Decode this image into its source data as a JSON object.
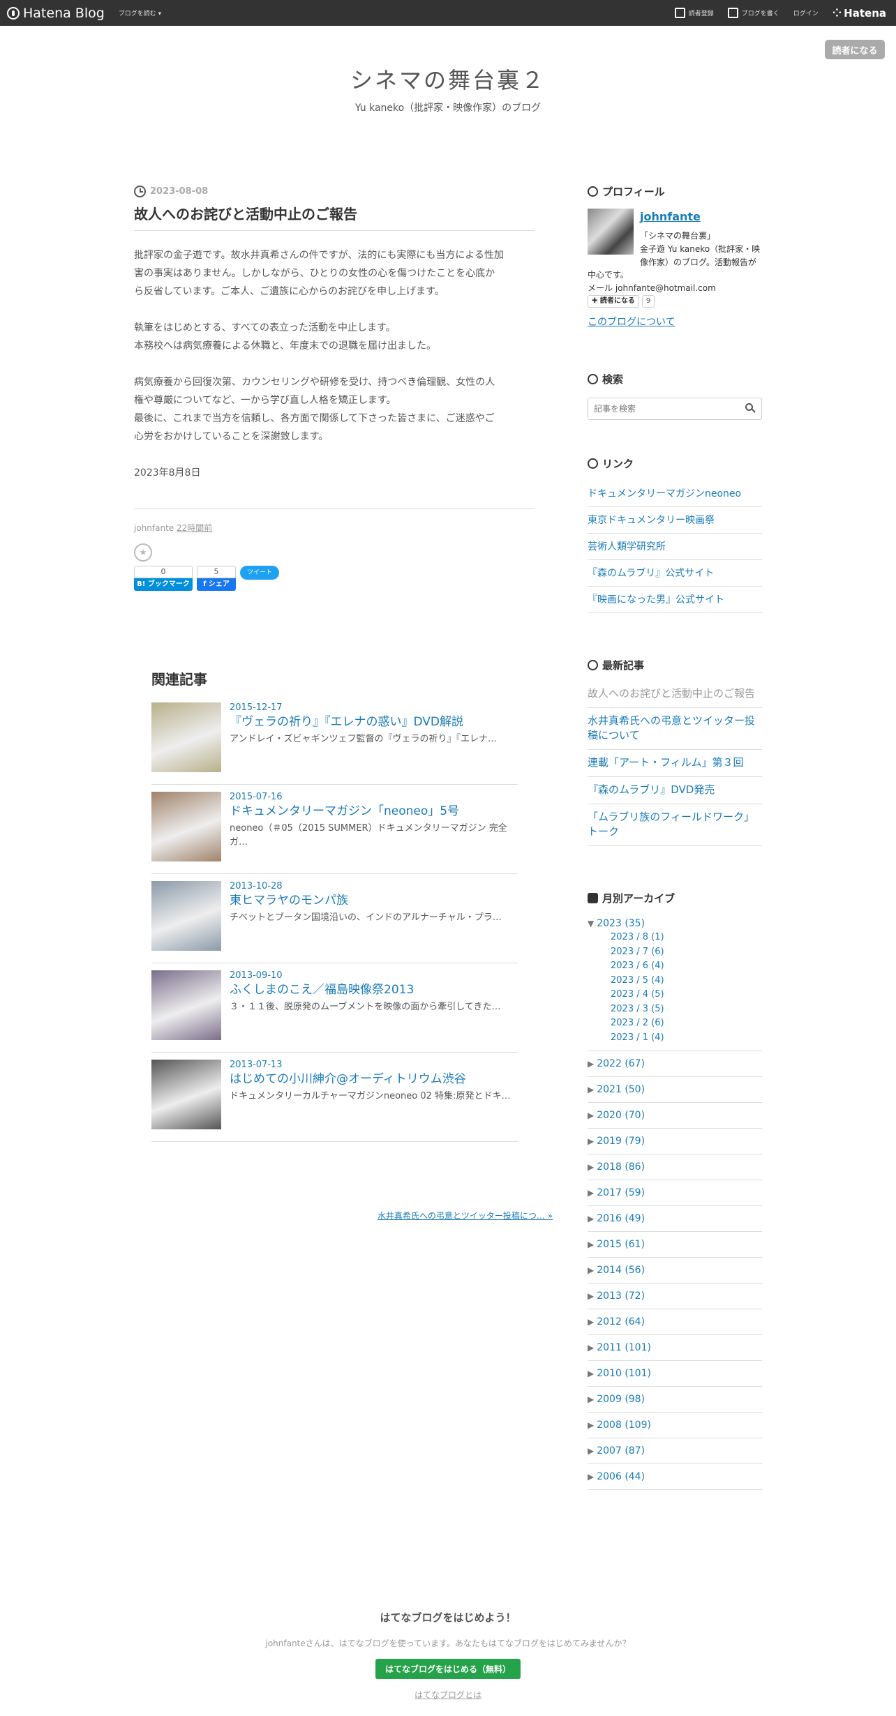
{
  "topbar": {
    "logo": "Hatena Blog",
    "menu": "ブログを読む ▾",
    "right_items": [
      "読者登録",
      "ブログを書く",
      "ログイン"
    ],
    "brand": "Hatena"
  },
  "subscribe_button": "読者になる",
  "header": {
    "title": "シネマの舞台裏２",
    "description": "Yu kaneko（批評家・映像作家）のブログ"
  },
  "entry": {
    "date": "2023-08-08",
    "title": "故人へのお詫びと活動中止のご報告",
    "paragraphs": [
      [
        "批評家の金子遊です。故水井真希さんの件ですが、法的にも実際にも当方による性加",
        "害の事実はありません。しかしながら、ひとりの女性の心を傷つけたことを心底か",
        "ら反省しています。ご本人、ご遺族に心からのお詫びを申し上げます。"
      ],
      [
        "執筆をはじめとする、すべての表立った活動を中止します。",
        "本務校へは病気療養による休職と、年度末での退職を届け出ました。"
      ],
      [
        "病気療養から回復次第、カウンセリングや研修を受け、持つべき倫理観、女性の人",
        "権や尊厳についてなど、一から学び直し人格を矯正します。",
        "最後に、これまで当方を信頼し、各方面で関係して下さった皆さまに、ご迷惑やご",
        "心労をおかけしていることを深謝致します。"
      ],
      [
        "2023年8月8日"
      ]
    ],
    "author": "johnfante",
    "time_ago": "22時間前",
    "share": {
      "hatebu_count": "0",
      "hatebu_label": "B! ブックマーク",
      "fb_count": "5",
      "fb_label": "f シェア",
      "tweet_label": "ツイート"
    }
  },
  "related": {
    "heading": "関連記事",
    "items": [
      {
        "date": "2015-12-17",
        "title": "『ヴェラの祈り』『エレナの惑い』DVD解説",
        "snippet": "アンドレイ・ズビャギンツェフ監督の『ヴェラの祈り』『エレナ…",
        "thumb_color": "#b8b08a"
      },
      {
        "date": "2015-07-16",
        "title": "ドキュメンタリーマガジン「neoneo」5号",
        "snippet": "neoneo（＃05（2015 SUMMER）ドキュメンタリーマガジン 完全ガ…",
        "thumb_color": "#a0826a"
      },
      {
        "date": "2013-10-28",
        "title": "東ヒマラヤのモンパ族",
        "snippet": "チベットとブータン国境沿いの、インドのアルナーチャル・プラ…",
        "thumb_color": "#8a9aa8"
      },
      {
        "date": "2013-09-10",
        "title": "ふくしまのこえ／福島映像祭2013",
        "snippet": "３・１１後、脱原発のムーブメントを映像の面から牽引してきた…",
        "thumb_color": "#7a6e8a"
      },
      {
        "date": "2013-07-13",
        "title": "はじめての小川紳介@オーディトリウム渋谷",
        "snippet": "ドキュメンタリーカルチャーマガジンneoneo 02 特集:原発とドキ…",
        "thumb_color": "#555555"
      }
    ]
  },
  "next_link": "水井真希氏への弔意とツイッター投稿につ… »",
  "sidebar": {
    "profile": {
      "heading": "プロフィール",
      "name": "johnfante",
      "desc_lines": [
        "「シネマの舞台裏」",
        "金子遊 Yu kaneko（批評家・映",
        "像作家）のブログ。活動報告が"
      ],
      "desc_rest": [
        "中心です。",
        "メール johnfante@hotmail.com"
      ],
      "reader_button": "✚ 読者になる",
      "reader_count": "9",
      "about_link": "このブログについて"
    },
    "search": {
      "heading": "検索",
      "placeholder": "記事を検索"
    },
    "links": {
      "heading": "リンク",
      "items": [
        "ドキュメンタリーマガジンneoneo",
        "東京ドキュメンタリー映画祭",
        "芸術人類学研究所",
        "『森のムラブリ』公式サイト",
        "『映画になった男』公式サイト"
      ]
    },
    "recent": {
      "heading": "最新記事",
      "items": [
        "故人へのお詫びと活動中止のご報告",
        "水井真希氏への弔意とツイッター投稿について",
        "連載「アート・フィルム」第３回",
        "『森のムラブリ』DVD発売",
        "「ムラブリ族のフィールドワーク」トーク"
      ]
    },
    "archive": {
      "heading": "月別アーカイブ",
      "open_year": "2023 (35)",
      "months": [
        "2023 / 8 (1)",
        "2023 / 7 (6)",
        "2023 / 6 (4)",
        "2023 / 5 (4)",
        "2023 / 4 (5)",
        "2023 / 3 (5)",
        "2023 / 2 (6)",
        "2023 / 1 (4)"
      ],
      "years": [
        "2022 (67)",
        "2021 (50)",
        "2020 (70)",
        "2019 (79)",
        "2018 (86)",
        "2017 (59)",
        "2016 (49)",
        "2015 (61)",
        "2014 (56)",
        "2013 (72)",
        "2012 (64)",
        "2011 (101)",
        "2010 (101)",
        "2009 (98)",
        "2008 (109)",
        "2007 (87)",
        "2006 (44)"
      ]
    }
  },
  "footer": {
    "title": "はてなブログをはじめよう！",
    "text": "johnfanteさんは、はてなブログを使っています。あなたもはてなブログをはじめてみませんか？",
    "cta": "はてなブログをはじめる（無料）",
    "about": "はてなブログとは"
  }
}
